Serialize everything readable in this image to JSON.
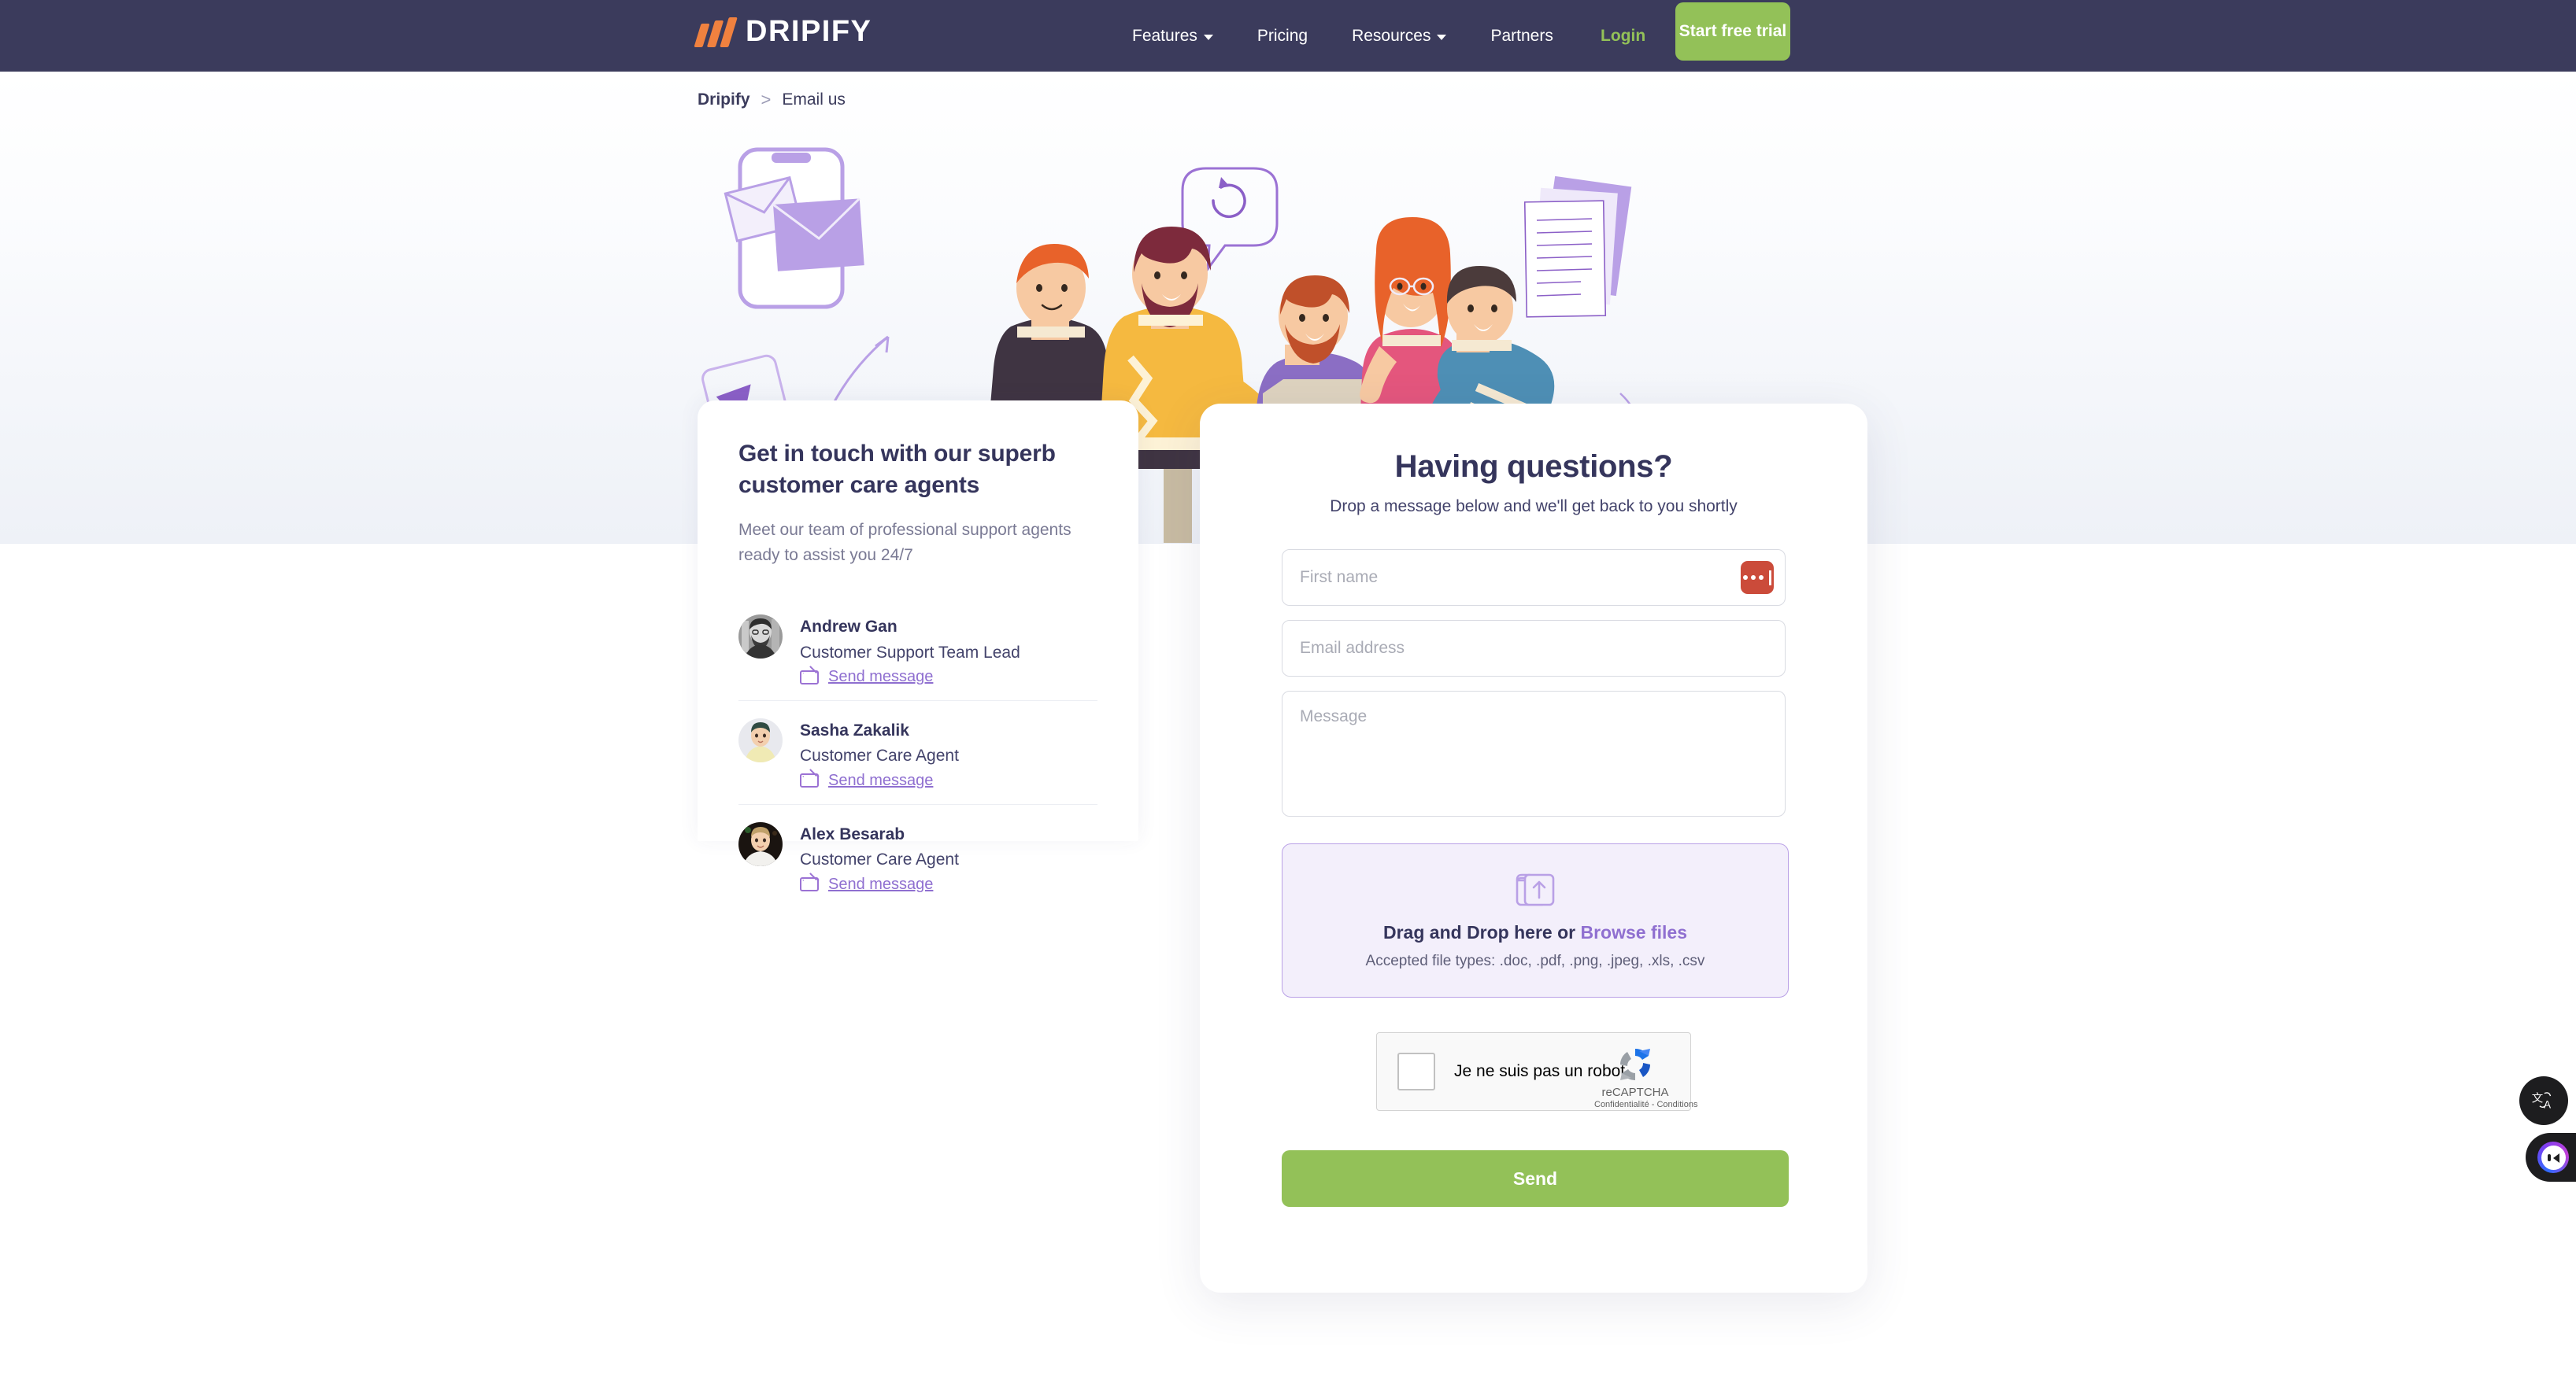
{
  "nav": {
    "logo_text": "DRIPIFY",
    "logo_icon": "dripify-slashes-logo",
    "links": [
      {
        "label": "Features",
        "has_caret": true
      },
      {
        "label": "Pricing",
        "has_caret": false
      },
      {
        "label": "Resources",
        "has_caret": true
      },
      {
        "label": "Partners",
        "has_caret": false
      }
    ],
    "login_label": "Login",
    "cta_label": "Start free trial",
    "bg_color": "#3b3b5c",
    "cta_color": "#93c158",
    "login_color": "#93c158"
  },
  "breadcrumb": {
    "home": "Dripify",
    "separator": ">",
    "current": "Email us"
  },
  "left_card": {
    "title": "Get in touch with our superb customer care agents",
    "subtitle": "Meet our team of professional support agents ready to assist you 24/7",
    "agents": [
      {
        "name": "Andrew Gan",
        "role": "Customer Support Team Lead",
        "action_label": "Send message",
        "action_icon": "envelope-icon",
        "avatar": "photo-man-glasses-beard-grayscale"
      },
      {
        "name": "Sasha Zakalik",
        "role": "Customer Care Agent",
        "action_label": "Send message",
        "action_icon": "envelope-icon",
        "avatar": "photo-woman-yellow-sweater"
      },
      {
        "name": "Alex Besarab",
        "role": "Customer Care Agent",
        "action_label": "Send message",
        "action_icon": "envelope-icon",
        "avatar": "photo-man-white-shirt-dark-bg"
      }
    ]
  },
  "form": {
    "title": "Having questions?",
    "subtitle": "Drop a message below and we'll get back to you shortly",
    "first_name": {
      "value": "",
      "placeholder": "First name"
    },
    "email": {
      "value": "",
      "placeholder": "Email address"
    },
    "message": {
      "value": "",
      "placeholder": "Message"
    },
    "password_manager_badge": {
      "icon": "password-manager-dots-icon",
      "color": "#cb4b3a"
    },
    "dropzone": {
      "icon": "folder-upload-icon",
      "main_text": "Drag and Drop here",
      "or_text": "or",
      "browse_label": "Browse files",
      "accepted_text": "Accepted file types: .doc, .pdf, .png, .jpeg, .xls, .csv",
      "bg_color": "#f3effb",
      "border_color": "#b9a0e6"
    },
    "recaptcha": {
      "checkbox_label": "Je ne suis pas un robot",
      "brand": "reCAPTCHA",
      "legal": "Confidentialité - Conditions",
      "logo_icon": "recaptcha-icon",
      "checked": false
    },
    "submit_label": "Send",
    "submit_color": "#93c158"
  },
  "floating": {
    "translate": {
      "icon": "translate-icon",
      "glyph": "文A"
    },
    "chat": {
      "icon": "chat-assistant-icon"
    }
  },
  "illustration": {
    "name": "customer-support-team-illustration",
    "elements": [
      "phone",
      "envelopes",
      "refresh-speech-bubble",
      "document-pages",
      "five-support-agents",
      "desk",
      "laptop",
      "paper-plane"
    ]
  }
}
